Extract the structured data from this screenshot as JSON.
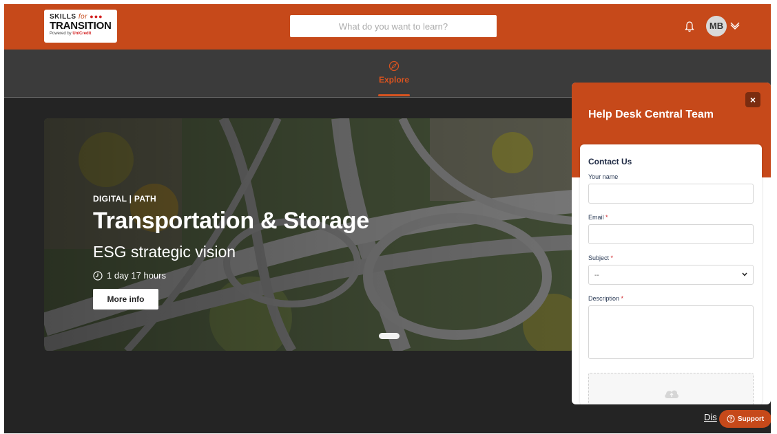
{
  "header": {
    "logo": {
      "line1_skills": "SKILLS",
      "line1_for": "for",
      "line1_dots": "●●●",
      "line2": "TRANSITION",
      "line3_prefix": "Powered by",
      "line3_brand": "UniCredit"
    },
    "search_placeholder": "What do you want to learn?",
    "avatar_initials": "MB",
    "icons": {
      "notifications": "bell-icon",
      "user_menu": "chevron-down-icon"
    }
  },
  "nav": {
    "explore_label": "Explore",
    "explore_icon": "compass-icon",
    "active_color": "#d8531f"
  },
  "hero": {
    "category": "DIGITAL | PATH",
    "title": "Transportation & Storage",
    "subtitle": "ESG strategic vision",
    "duration": "1 day 17 hours",
    "duration_icon": "clock-icon",
    "more_info_label": "More info"
  },
  "help_panel": {
    "title": "Help Desk Central Team",
    "close_label": "×",
    "form_title": "Contact Us",
    "fields": {
      "name_label": "Your name",
      "email_label": "Email",
      "subject_label": "Subject",
      "subject_value": "--",
      "description_label": "Description",
      "required_mark": "*"
    },
    "upload_icon": "cloud-upload-icon"
  },
  "footer": {
    "disclaimer_partial": "Dis",
    "support_label": "Support",
    "support_icon": "question-circle-icon"
  },
  "colors": {
    "brand": "#c6491a",
    "page_bg": "#242424",
    "nav_bg": "#3b3b3b"
  }
}
